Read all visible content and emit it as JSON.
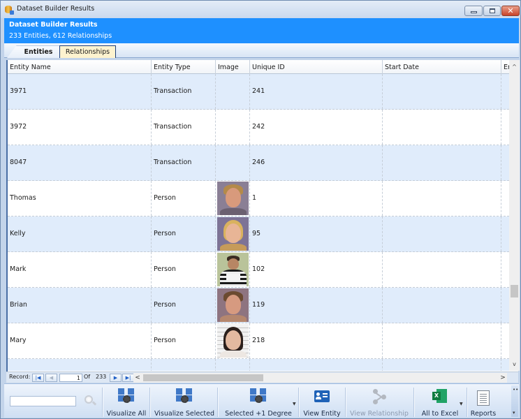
{
  "window": {
    "title": "Dataset Builder Results",
    "controls": {
      "minimize": "minimize",
      "maximize": "maximize",
      "close": "close"
    }
  },
  "banner": {
    "title": "Dataset Builder Results",
    "subtitle": "233 Entities, 612 Relationships"
  },
  "tabs": [
    {
      "label": "Entities",
      "active": true
    },
    {
      "label": "Relationships",
      "active": false
    }
  ],
  "grid": {
    "columns": [
      "Entity Name",
      "Entity Type",
      "Image",
      "Unique ID",
      "Start Date",
      "Er"
    ],
    "rows": [
      {
        "name": "3971",
        "type": "Transaction",
        "image": "",
        "uid": "241",
        "start": "",
        "end": ""
      },
      {
        "name": "3972",
        "type": "Transaction",
        "image": "",
        "uid": "242",
        "start": "",
        "end": ""
      },
      {
        "name": "8047",
        "type": "Transaction",
        "image": "",
        "uid": "246",
        "start": "",
        "end": ""
      },
      {
        "name": "Thomas",
        "type": "Person",
        "image": "mugshot-photo",
        "uid": "1",
        "start": "",
        "end": ""
      },
      {
        "name": "Kelly",
        "type": "Person",
        "image": "mugshot-photo",
        "uid": "95",
        "start": "",
        "end": ""
      },
      {
        "name": "Mark",
        "type": "Person",
        "image": "booking-photo-with-placard",
        "uid": "102",
        "start": "",
        "end": ""
      },
      {
        "name": "Brian",
        "type": "Person",
        "image": "mugshot-photo",
        "uid": "119",
        "start": "",
        "end": ""
      },
      {
        "name": "Mary",
        "type": "Person",
        "image": "mugshot-height-chart-photo",
        "uid": "218",
        "start": "",
        "end": ""
      },
      {
        "name": "",
        "type": "",
        "image": "",
        "uid": "",
        "start": "",
        "end": ""
      }
    ]
  },
  "navigator": {
    "record_label": "Record:",
    "current": "1",
    "of_label": "Of",
    "total": "233",
    "first_icon": "first-record-icon",
    "prev_icon": "previous-record-icon",
    "next_icon": "next-record-icon",
    "last_icon": "last-record-icon"
  },
  "scroll": {
    "up": "^",
    "down": "v",
    "left": "<",
    "right": ">"
  },
  "toolbar": {
    "search_placeholder": "",
    "search_value": "",
    "buttons": [
      {
        "label": "Visualize All",
        "icon": "visualize-icon",
        "enabled": true
      },
      {
        "label": "Visualize Selected",
        "icon": "visualize-icon",
        "enabled": true
      },
      {
        "label": "Selected +1 Degree",
        "icon": "visualize-icon",
        "enabled": true,
        "dropdown": true
      },
      {
        "label": "View Entity",
        "icon": "entity-card-icon",
        "enabled": true
      },
      {
        "label": "View Relationship",
        "icon": "relationship-icon",
        "enabled": false
      },
      {
        "label": "All to Excel",
        "icon": "excel-icon",
        "enabled": true,
        "dropdown": true
      },
      {
        "label": "Reports",
        "icon": "report-icon",
        "enabled": true
      }
    ],
    "excel_letter": "X",
    "overflow_dots": "••",
    "overflow_arrow": "▾"
  },
  "colors": {
    "banner": "#1e90ff",
    "row_alt": "#e0ecfb",
    "active_tab_bg": "#fdf3cf"
  }
}
